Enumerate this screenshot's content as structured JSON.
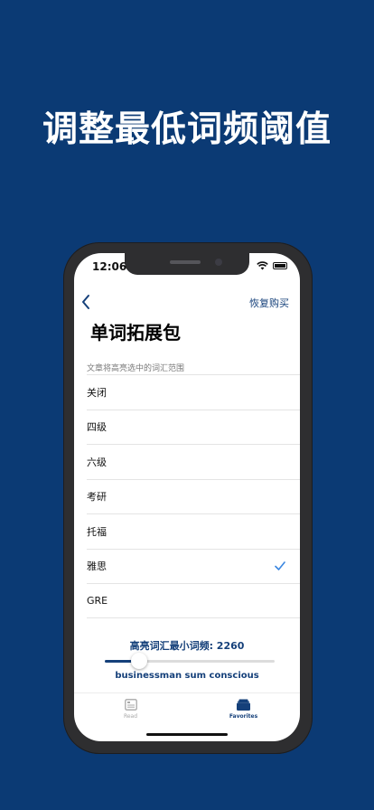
{
  "headline": "调整最低词频阈值",
  "status_bar": {
    "time": "12:06"
  },
  "nav": {
    "restore_label": "恢复购买"
  },
  "page_title": "单词拓展包",
  "section_header": "文章将高亮选中的词汇范围",
  "options": [
    {
      "label": "关闭",
      "selected": false
    },
    {
      "label": "四级",
      "selected": false
    },
    {
      "label": "六级",
      "selected": false
    },
    {
      "label": "考研",
      "selected": false
    },
    {
      "label": "托福",
      "selected": false
    },
    {
      "label": "雅思",
      "selected": true
    },
    {
      "label": "GRE",
      "selected": false
    }
  ],
  "frequency": {
    "label": "高亮词汇最小词频: 2260",
    "slider_fraction": 0.2,
    "sample_words": "businessman sum conscious"
  },
  "tabbar": {
    "tabs": [
      {
        "label": "Read",
        "icon": "document-icon",
        "active": false
      },
      {
        "label": "Favorites",
        "icon": "folder-stack-icon",
        "active": true
      }
    ]
  },
  "colors": {
    "background": "#0b3a74",
    "accent": "#15407a",
    "check": "#3a86e0"
  }
}
